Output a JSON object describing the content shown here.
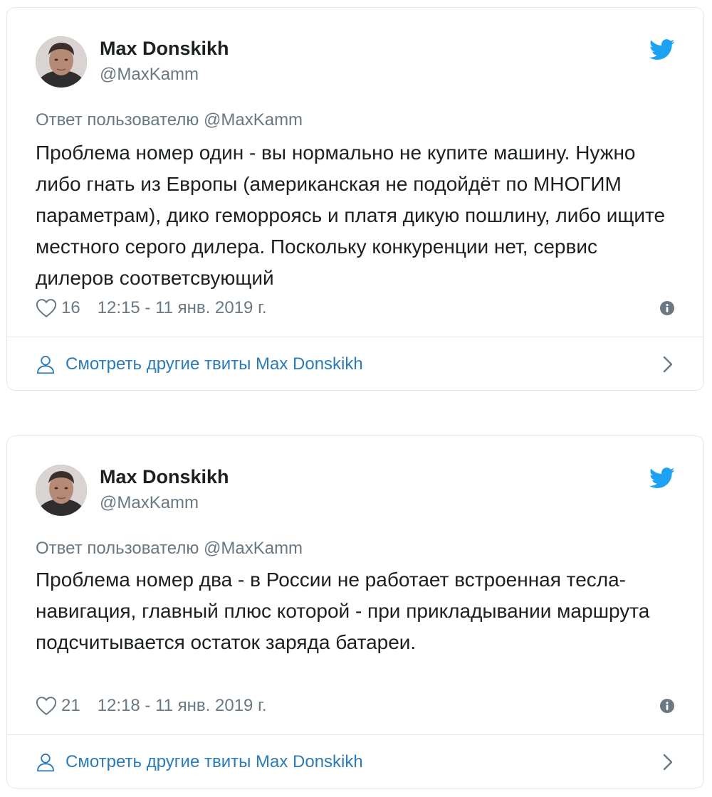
{
  "tweets": [
    {
      "author_name": "Max Donskikh",
      "author_handle": "@MaxKamm",
      "reply_to": "Ответ пользователю @MaxKamm",
      "text": "Проблема номер один - вы нормально не купите машину. Нужно либо гнать из Европы (американская не подойдёт по МНОГИМ параметрам), дико геморроясь и платя дикую пошлину, либо ищите местного серого дилера. Поскольку конкуренции нет, сервис дилеров соответсвующий",
      "likes": "16",
      "timestamp": "12:15 - 11 янв. 2019 г.",
      "more_link": "Смотреть другие твиты Max Donskikh"
    },
    {
      "author_name": "Max Donskikh",
      "author_handle": "@MaxKamm",
      "reply_to": "Ответ пользователю @MaxKamm",
      "text": "Проблема номер два - в России не работает встроенная тесла-навигация, главный плюс которой - при прикладывании маршрута подсчитывается остаток заряда батареи.",
      "likes": "21",
      "timestamp": "12:18 - 11 янв. 2019 г.",
      "more_link": "Смотреть другие твиты Max Donskikh"
    }
  ],
  "icons": {
    "brand": "twitter-bird-icon",
    "like": "heart-icon",
    "info": "info-icon",
    "profile": "person-icon",
    "arrow": "chevron-right-icon"
  },
  "colors": {
    "twitter_blue": "#1da1f2",
    "link_blue": "#2b7bb9",
    "text_dark": "#1c2022",
    "text_muted": "#697882",
    "border": "#e1e8ed"
  }
}
